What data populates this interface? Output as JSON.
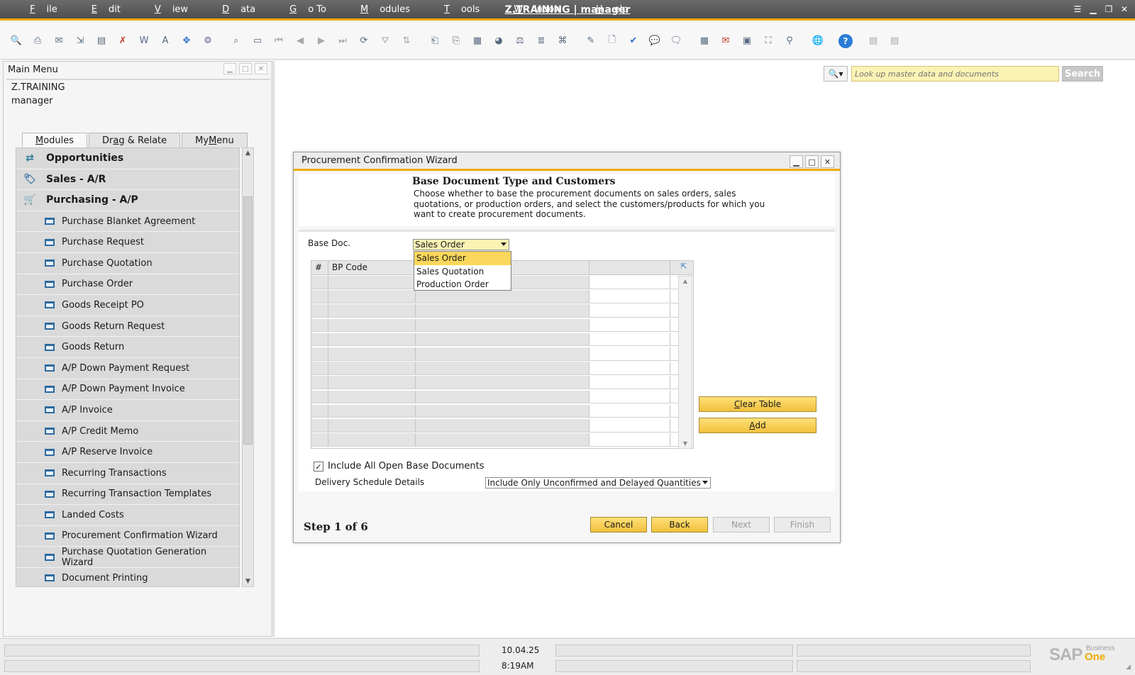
{
  "app": {
    "title": "Z.TRAINING | manager",
    "menus": [
      {
        "pre": "",
        "u": "F",
        "post": "ile"
      },
      {
        "pre": "",
        "u": "E",
        "post": "dit"
      },
      {
        "pre": "",
        "u": "V",
        "post": "iew"
      },
      {
        "pre": "",
        "u": "D",
        "post": "ata"
      },
      {
        "pre": "",
        "u": "G",
        "post": "o To"
      },
      {
        "pre": "",
        "u": "M",
        "post": "odules"
      },
      {
        "pre": "",
        "u": "T",
        "post": "ools"
      },
      {
        "pre": "",
        "u": "W",
        "post": "indow"
      },
      {
        "pre": "",
        "u": "H",
        "post": "elp"
      }
    ]
  },
  "toolbar": {
    "icons": [
      "preview-icon",
      "print-icon",
      "email-icon",
      "export-icon",
      "print-layout-icon",
      "excel-icon",
      "word-icon",
      "pdf-icon",
      "move-icon",
      "settings-icon",
      "find-icon",
      "add-icon",
      "first-record-icon",
      "previous-record-icon",
      "next-record-icon",
      "last-record-icon",
      "refresh-icon",
      "filter-icon",
      "sort-icon",
      "base-document-icon",
      "target-document-icon",
      "gross-profit-icon",
      "payment-icon",
      "volume-weight-icon",
      "journal-icon",
      "report-icon",
      "edit-icon",
      "new-document-icon",
      "approval-icon",
      "message-icon",
      "chat-icon",
      "calendar-icon",
      "alerts-icon",
      "planner-icon",
      "org-chart-icon",
      "user-icon",
      "web-icon",
      "help-icon",
      "widget-icon",
      "widget2-icon"
    ]
  },
  "main_menu": {
    "title": "Main Menu",
    "company": "Z.TRAINING",
    "user": "manager",
    "tabs": [
      {
        "pre": "",
        "u": "M",
        "post": "odules",
        "active": true
      },
      {
        "pre": "Dr",
        "u": "a",
        "post": "g & Relate",
        "active": false
      },
      {
        "pre": "My ",
        "u": "M",
        "post": "enu",
        "active": false
      }
    ],
    "modules": [
      {
        "label": "Opportunities",
        "top": true,
        "icon": "opportunities-icon"
      },
      {
        "label": "Sales - A/R",
        "top": true,
        "icon": "sales-icon"
      },
      {
        "label": "Purchasing - A/P",
        "top": true,
        "icon": "purchasing-cart-icon"
      },
      {
        "label": "Purchase Blanket Agreement",
        "top": false
      },
      {
        "label": "Purchase Request",
        "top": false
      },
      {
        "label": "Purchase Quotation",
        "top": false
      },
      {
        "label": "Purchase Order",
        "top": false
      },
      {
        "label": "Goods Receipt PO",
        "top": false
      },
      {
        "label": "Goods Return Request",
        "top": false
      },
      {
        "label": "Goods Return",
        "top": false
      },
      {
        "label": "A/P Down Payment Request",
        "top": false
      },
      {
        "label": "A/P Down Payment Invoice",
        "top": false
      },
      {
        "label": "A/P Invoice",
        "top": false
      },
      {
        "label": "A/P Credit Memo",
        "top": false
      },
      {
        "label": "A/P Reserve Invoice",
        "top": false
      },
      {
        "label": "Recurring Transactions",
        "top": false
      },
      {
        "label": "Recurring Transaction Templates",
        "top": false
      },
      {
        "label": "Landed Costs",
        "top": false
      },
      {
        "label": "Procurement Confirmation Wizard",
        "top": false
      },
      {
        "label": "Purchase Quotation Generation Wizard",
        "top": false
      },
      {
        "label": "Document Printing",
        "top": false
      }
    ]
  },
  "search": {
    "placeholder": "Look up master data and documents",
    "button": "Search"
  },
  "dialog": {
    "title": "Procurement Confirmation Wizard",
    "heading": "Base Document Type and Customers",
    "description": "Choose whether to base the procurement documents on sales orders, sales quotations, or production orders, and select the customers/products for which you want to create procurement documents.",
    "base_doc_label": "Base Doc.",
    "base_doc_value": "Sales Order",
    "dropdown_options": [
      "Sales Order",
      "Sales Quotation",
      "Production Order"
    ],
    "dropdown_selected_index": 0,
    "grid_columns": [
      "#",
      "BP Code",
      "",
      ""
    ],
    "grid_row_count": 12,
    "clear_table": {
      "pre": "",
      "u": "C",
      "post": "lear Table"
    },
    "add": {
      "pre": "",
      "u": "A",
      "post": "dd"
    },
    "include_all_label": "Include All Open Base Documents",
    "include_all_checked": true,
    "delivery_label": "Delivery Schedule Details",
    "delivery_value": "Include Only Unconfirmed and Delayed Quantities",
    "step": "Step 1 of 6",
    "buttons": {
      "cancel": "Cancel",
      "back": "Back",
      "next": "Next",
      "finish": "Finish"
    }
  },
  "status": {
    "date": "10.04.25",
    "time": "8:19AM"
  },
  "logo": {
    "sap": "SAP",
    "business": "Business",
    "one": "One"
  },
  "colors": {
    "accent": "#f0ab00",
    "field_yellow": "#fbf3b4",
    "button_yellow": "#f1c03c"
  }
}
